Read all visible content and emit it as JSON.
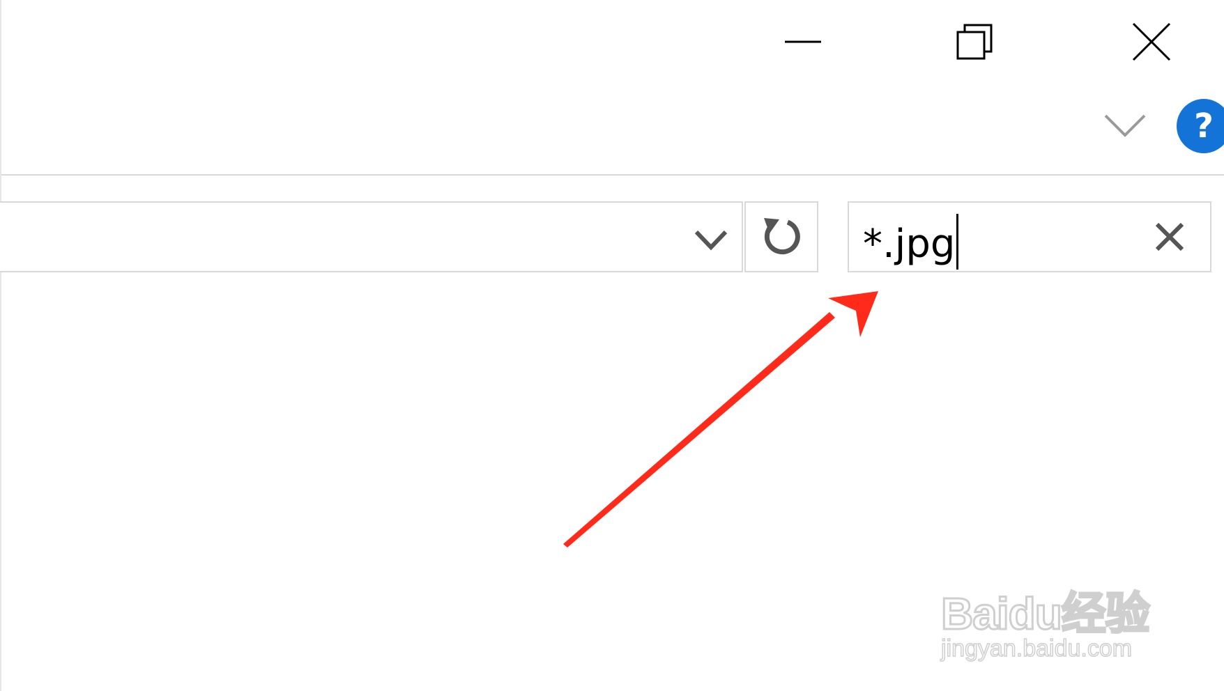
{
  "window": {
    "controls": {
      "minimize_icon": "minimize-icon",
      "restore_icon": "restore-icon",
      "close_icon": "close-icon"
    }
  },
  "ribbon": {
    "expand_icon": "chevron-down-icon",
    "help_label": "?",
    "help_color": "#1473d6"
  },
  "address_bar": {
    "value": "",
    "dropdown_icon": "chevron-down-icon",
    "refresh_icon": "refresh-icon"
  },
  "search": {
    "value": "*.jpg",
    "clear_icon": "clear-icon"
  },
  "annotation": {
    "type": "arrow",
    "color": "#ff2a1a"
  },
  "watermark": {
    "logo": "Baidu经验",
    "url": "jingyan.baidu.com"
  }
}
